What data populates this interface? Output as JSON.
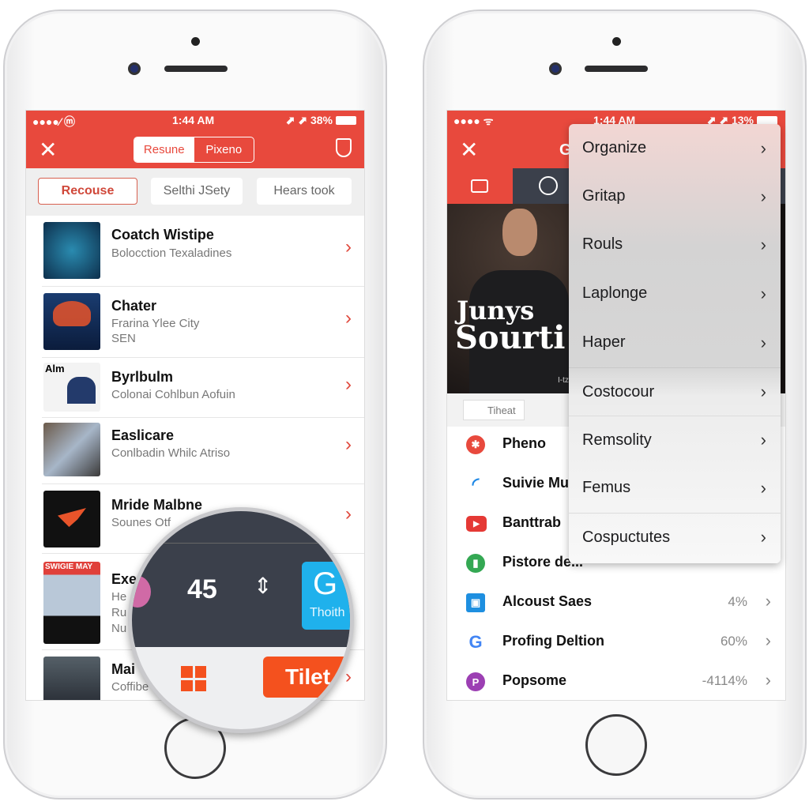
{
  "colors": {
    "accent": "#e8493d",
    "dark_bar": "#3b404b",
    "tile_blue": "#1fb1ec",
    "orange": "#f4511e"
  },
  "left_phone": {
    "status": {
      "carrier": "●●●●⁄ ⓜ",
      "time": "1:44 AM",
      "battery": "⬈ ⬈ 38%"
    },
    "nav": {
      "close_icon": "close-icon",
      "segments": [
        "Resune",
        "Pixeno"
      ],
      "share_icon": "share-icon"
    },
    "filters": [
      "Recouse",
      "Selthi JSety",
      "Hears took"
    ],
    "list": [
      {
        "title": "Coatch Wistipe",
        "subtitle": [
          "Bolocction Texaladines"
        ]
      },
      {
        "title": "Chater",
        "subtitle": [
          "Frarina Ylee City",
          "SEN"
        ]
      },
      {
        "title": "Byrlbulm",
        "subtitle": [
          "Colonai Cohlbun Aofuin"
        ],
        "thumb_text": "Alm"
      },
      {
        "title": "Easlicare",
        "subtitle": [
          "Conlbadin Whilc Atriso"
        ]
      },
      {
        "title": "Mride Malbne",
        "subtitle": [
          "Sounes Otf"
        ]
      },
      {
        "title": "Exe",
        "subtitle": [
          "He",
          "Ru",
          "Nu"
        ],
        "thumb_text": "SWIGIE MAY"
      },
      {
        "title": "Mai",
        "subtitle": [
          "Coffibe"
        ]
      }
    ],
    "magnifier": {
      "value": "45",
      "tile_letter": "G",
      "tile_label": "Thoith",
      "button": "Tilet"
    }
  },
  "right_phone": {
    "status": {
      "time": "1:44 AM",
      "battery": "⬈ ⬈ 13%"
    },
    "nav": {
      "title_partial": "G"
    },
    "hero": {
      "line1": "Junys",
      "line2": "Sourti",
      "caption": "I-tz"
    },
    "chip": "Tiheat",
    "menu": [
      "Organize",
      "Gritap",
      "Rouls",
      "Laplonge",
      "Haper",
      "Costocour",
      "Remsolity",
      "Femus",
      "Cospuctutes"
    ],
    "list": [
      {
        "title": "Pheno",
        "icon": "asterisk-icon",
        "value": ""
      },
      {
        "title": "Suivie Mu",
        "icon": "arc-icon",
        "value": ""
      },
      {
        "title": "Banttrab",
        "icon": "play-icon",
        "value": ""
      },
      {
        "title": "Pistore de...",
        "icon": "tablet-icon",
        "value": ""
      },
      {
        "title": "Alcoust Saes",
        "icon": "briefcase-icon",
        "value": "4%"
      },
      {
        "title": "Profing Deltion",
        "icon": "google-icon",
        "value": "60%"
      },
      {
        "title": "Popsome",
        "icon": "pinterest-icon",
        "value": "-4114%"
      }
    ]
  }
}
